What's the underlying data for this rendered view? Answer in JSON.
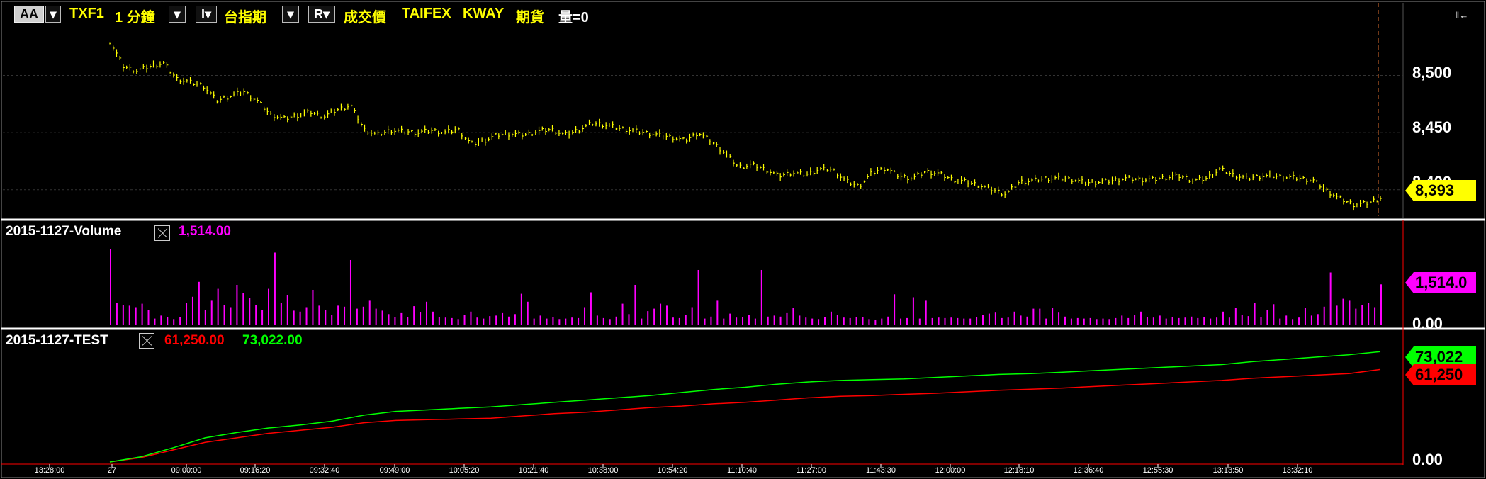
{
  "toolbar": {
    "aa_label": "AA",
    "symbol": "TXF1",
    "interval": "1 分鐘",
    "i_label": "I",
    "index_label": "台指期",
    "r_label": "R",
    "price_type": "成交價",
    "exchange": "TAIFEX",
    "source": "KWAY",
    "category": "期貨",
    "volume_text": "量=0",
    "corner_label": "Ⅱ←"
  },
  "panes": {
    "price": {
      "yticks": [
        "8,500",
        "8,450",
        "8,400"
      ],
      "last_label": "8,393"
    },
    "volume": {
      "title": "2015-1127-Volume",
      "value": "1,514.00",
      "yticks": [
        "1,514.0",
        "0.00"
      ]
    },
    "test": {
      "title": "2015-1127-TEST",
      "value_red": "61,250.00",
      "value_green": "73,022.00",
      "tag_green": "73,022",
      "tag_red": "61,250",
      "ytick_zero": "0.00"
    }
  },
  "xticks": [
    "13:28:00",
    "27",
    "09:00:00",
    "09:16:20",
    "09:32:40",
    "09:49:00",
    "10:05:20",
    "10:21:40",
    "10:38:00",
    "10:54:20",
    "11:10:40",
    "11:27:00",
    "11:43:30",
    "12:00:00",
    "12:18:10",
    "12:36:40",
    "12:55:30",
    "13:13:50",
    "13:32:10"
  ],
  "colors": {
    "price": "#ffff00",
    "volume": "#ff00ff",
    "red": "#ff0000",
    "green": "#00ff00",
    "grid": "#333333"
  },
  "chart_data": [
    {
      "type": "line",
      "title": "TXF1 1 分鐘",
      "ylim": [
        8380,
        8540
      ],
      "series": [
        {
          "name": "成交價",
          "values": [
            8530,
            8508,
            8504,
            8508,
            8511,
            8497,
            8494,
            8491,
            8478,
            8482,
            8486,
            8478,
            8466,
            8462,
            8465,
            8468,
            8464,
            8470,
            8474,
            8453,
            8448,
            8452,
            8451,
            8450,
            8452,
            8450,
            8453,
            8440,
            8443,
            8448,
            8449,
            8448,
            8451,
            8453,
            8448,
            8452,
            8458,
            8457,
            8454,
            8452,
            8450,
            8448,
            8446,
            8443,
            8450,
            8442,
            8432,
            8420,
            8422,
            8418,
            8412,
            8415,
            8413,
            8418,
            8418,
            8408,
            8403,
            8415,
            8419,
            8412,
            8410,
            8416,
            8414,
            8409,
            8407,
            8404,
            8400,
            8396,
            8407,
            8408,
            8410,
            8410,
            8409,
            8406,
            8407,
            8408,
            8410,
            8409,
            8409,
            8411,
            8412,
            8408,
            8410,
            8418,
            8413,
            8410,
            8412,
            8412,
            8411,
            8410,
            8408,
            8399,
            8392,
            8387,
            8388,
            8393
          ]
        }
      ]
    },
    {
      "type": "bar",
      "title": "2015-1127-Volume",
      "ylim": [
        0,
        1514
      ],
      "series": [
        {
          "name": "2015-1127-Volume",
          "values": [
            1514,
            430,
            390,
            380,
            350,
            420,
            300,
            120,
            180,
            150,
            110,
            150,
            430,
            560,
            860,
            300,
            480,
            720,
            400,
            350,
            800,
            640,
            530,
            400,
            290,
            720,
            1450,
            430,
            600,
            280,
            260,
            350,
            700,
            380,
            300,
            200,
            380,
            360,
            1300,
            320,
            360,
            480,
            320,
            280,
            210,
            150,
            230,
            150,
            370,
            250,
            460,
            260,
            150,
            140,
            130,
            110,
            200,
            260,
            140,
            120,
            170,
            180,
            230,
            160,
            210,
            620,
            460,
            120,
            180,
            120,
            150,
            110,
            120,
            140,
            130,
            350,
            650,
            180,
            130,
            110,
            160,
            420,
            210,
            800,
            120,
            270,
            320,
            420,
            380,
            140,
            130,
            200,
            350,
            1100,
            120,
            160,
            480,
            120,
            220,
            140,
            150,
            200,
            120,
            1100,
            160,
            180,
            160,
            230,
            340,
            180,
            140,
            120,
            110,
            150,
            260,
            190,
            140,
            130,
            150,
            150,
            110,
            100,
            120,
            160,
            610,
            120,
            130,
            550,
            120,
            480,
            130,
            140,
            130,
            140,
            130,
            120,
            120,
            150,
            200,
            220,
            240,
            130,
            140,
            260,
            180,
            160,
            320,
            320,
            120,
            340,
            240,
            160,
            120,
            130,
            120,
            130,
            110,
            120,
            110,
            130,
            180,
            130,
            200,
            260,
            150,
            140,
            180,
            120,
            150,
            130,
            140,
            160,
            130,
            150,
            120,
            140,
            260,
            140,
            330,
            200,
            170,
            440,
            150,
            300,
            410,
            120,
            180,
            110,
            140,
            340,
            180,
            210,
            360,
            1050,
            380,
            520,
            480,
            320,
            390,
            440,
            350,
            810
          ]
        }
      ]
    },
    {
      "type": "line",
      "title": "2015-1127-TEST",
      "ylim": [
        0,
        76000
      ],
      "series": [
        {
          "name": "61,250.00",
          "values": [
            0,
            3000,
            8000,
            13000,
            16000,
            19000,
            21000,
            23000,
            26000,
            27500,
            28000,
            28500,
            29000,
            30500,
            32000,
            33000,
            34500,
            36000,
            37000,
            38500,
            39500,
            41000,
            42500,
            43500,
            44000,
            44800,
            45500,
            46500,
            47500,
            48200,
            49000,
            50000,
            51000,
            52000,
            53000,
            54000,
            55500,
            56500,
            57500,
            58500,
            61250
          ]
        },
        {
          "name": "73,022.00",
          "values": [
            0,
            3500,
            9500,
            16000,
            19500,
            22500,
            24500,
            27000,
            31000,
            33500,
            34500,
            35500,
            36500,
            38000,
            39500,
            41000,
            42500,
            44000,
            46000,
            48000,
            49500,
            51500,
            53000,
            54000,
            54500,
            55000,
            56000,
            57000,
            58000,
            58500,
            59500,
            60500,
            61500,
            62500,
            63500,
            64500,
            66500,
            68000,
            69500,
            71000,
            73022
          ]
        }
      ]
    }
  ]
}
